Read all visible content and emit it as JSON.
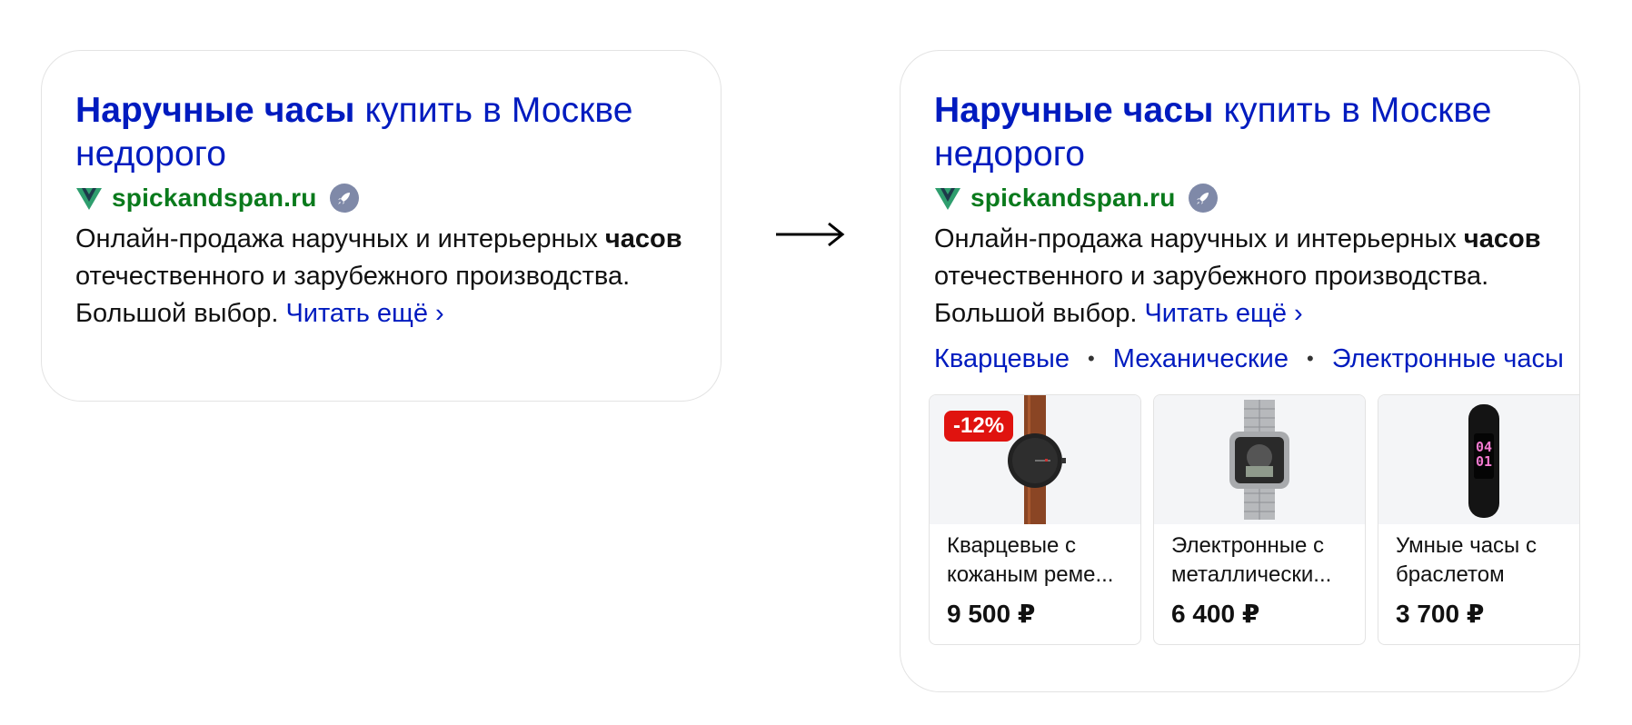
{
  "left_card": {
    "title_bold": "Наручные часы",
    "title_rest": " купить в Москве недорого",
    "site": "spickandspan.ru",
    "desc_line1": "Онлайн-продажа наручных и интерьерных ",
    "desc_bold": "часов",
    "desc_line2": " отечественного и зарубежного производства. Большой выбор. ",
    "read_more": "Читать ещё ›"
  },
  "right_card": {
    "title_bold": "Наручные часы",
    "title_rest": " купить в Москве недорого",
    "site": "spickandspan.ru",
    "desc_line1": "Онлайн-продажа наручных и интерьерных ",
    "desc_bold": "часов",
    "desc_line2": " отечественного и зарубежного производства. Большой выбор. ",
    "read_more": "Читать ещё ›",
    "quick_links": [
      "Кварцевые",
      "Механические",
      "Электронные часы"
    ],
    "separator": "•",
    "products": [
      {
        "name": "Кварцевые с кожаным реме...",
        "price": "9 500 ₽",
        "badge": "-12%"
      },
      {
        "name": "Электронные с металлически...",
        "price": "6 400 ₽"
      },
      {
        "name": "Умные часы с браслетом",
        "price": "3 700 ₽"
      }
    ]
  },
  "icons": {
    "favicon": "vue-v-logo-icon",
    "rocket": "rocket-icon",
    "arrow": "right-arrow-icon"
  },
  "colors": {
    "link": "#001bbf",
    "site": "#0a7a1c",
    "badge": "#e0130f",
    "rocket_bg": "#7f89a8"
  }
}
